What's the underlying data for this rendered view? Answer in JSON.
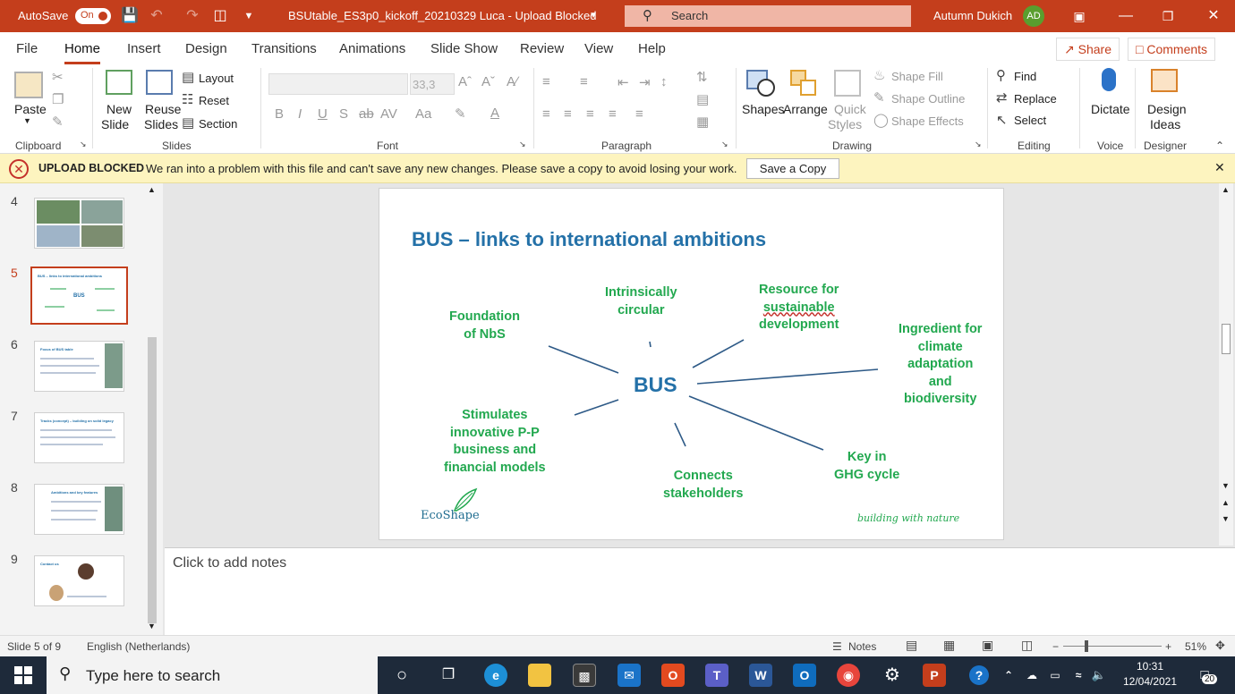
{
  "titlebar": {
    "autosave_label": "AutoSave",
    "autosave_state": "On",
    "doc_title": "BSUtable_ES3p0_kickoff_20210329 Luca  -  Upload Blocked",
    "search_placeholder": "Search",
    "user_name": "Autumn Dukich",
    "user_initials": "AD"
  },
  "menu": {
    "tabs": [
      "File",
      "Home",
      "Insert",
      "Design",
      "Transitions",
      "Animations",
      "Slide Show",
      "Review",
      "View",
      "Help"
    ],
    "active": "Home",
    "share": "Share",
    "comments": "Comments"
  },
  "ribbon": {
    "clipboard": {
      "paste": "Paste",
      "group": "Clipboard"
    },
    "slides": {
      "new_slide": [
        "New",
        "Slide"
      ],
      "reuse_slides": [
        "Reuse",
        "Slides"
      ],
      "layout": "Layout",
      "reset": "Reset",
      "section": "Section",
      "group": "Slides"
    },
    "font": {
      "font_size": "33,3",
      "group": "Font",
      "bold": "B",
      "italic": "I",
      "underline": "U",
      "shadow": "S",
      "strike": "ab",
      "spacing": "AV",
      "case": "Aa"
    },
    "paragraph": {
      "group": "Paragraph"
    },
    "drawing": {
      "shapes": "Shapes",
      "arrange": "Arrange",
      "quick_styles": [
        "Quick",
        "Styles"
      ],
      "shape_fill": "Shape Fill",
      "shape_outline": "Shape Outline",
      "shape_effects": "Shape Effects",
      "group": "Drawing"
    },
    "editing": {
      "find": "Find",
      "replace": "Replace",
      "select": "Select",
      "group": "Editing"
    },
    "voice": {
      "dictate": "Dictate",
      "group": "Voice"
    },
    "designer": {
      "design_ideas": [
        "Design",
        "Ideas"
      ],
      "group": "Designer"
    }
  },
  "infobar": {
    "title": "UPLOAD BLOCKED",
    "message": "We ran into a problem with this file and can't save any new changes. Please save a copy to avoid losing your work.",
    "button": "Save a Copy"
  },
  "thumbnails": [
    {
      "num": "4",
      "title": ""
    },
    {
      "num": "5",
      "title": "BUS – links to international ambitions",
      "selected": true
    },
    {
      "num": "6",
      "title": "Focus of BUS table"
    },
    {
      "num": "7",
      "title": "Tracks (concept) – building on solid legacy"
    },
    {
      "num": "8",
      "title": "Ambitions and key features"
    },
    {
      "num": "9",
      "title": "Contact us"
    }
  ],
  "slide": {
    "title": "BUS – links to international ambitions",
    "center": "BUS",
    "items": {
      "foundation": [
        "Foundation",
        "of  NbS"
      ],
      "circular": [
        "Intrinsically",
        "circular"
      ],
      "resource": [
        "Resource for",
        "sustainable",
        "development"
      ],
      "ingredient": [
        "Ingredient for",
        "climate",
        "adaptation",
        "and",
        "biodiversity"
      ],
      "ghg": [
        "Key in",
        "GHG cycle"
      ],
      "stakeholders": [
        "Connects",
        "stakeholders"
      ],
      "stimulates": [
        "Stimulates",
        "innovative P-P",
        "business and",
        "financial models"
      ]
    },
    "logo_text": "EcoShape",
    "tagline": "building with nature"
  },
  "notes": {
    "placeholder": "Click to add notes"
  },
  "status": {
    "slide_info": "Slide 5 of 9",
    "language": "English (Netherlands)",
    "notes_label": "Notes",
    "zoom": "51%"
  },
  "taskbar": {
    "search_placeholder": "Type here to search",
    "time": "10:31",
    "date": "12/04/2021",
    "notification_count": "20"
  }
}
